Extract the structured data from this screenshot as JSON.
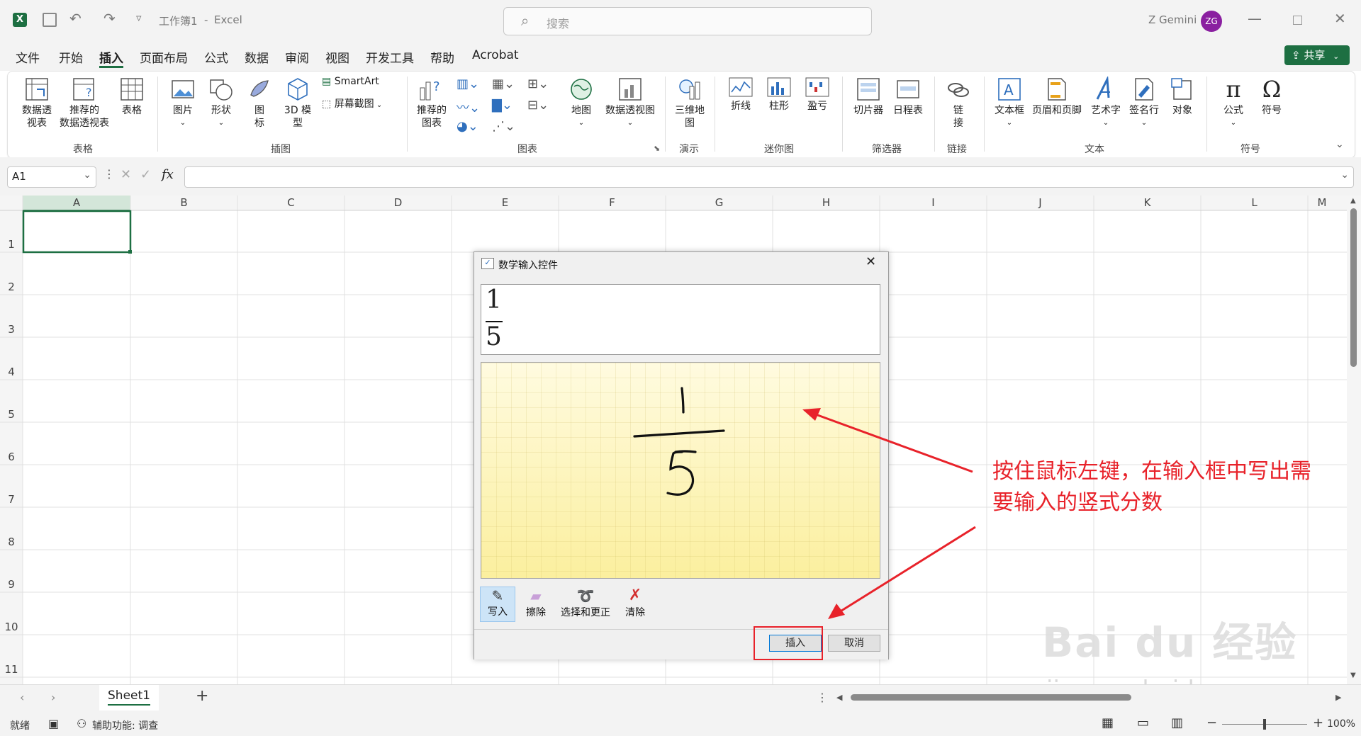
{
  "titlebar": {
    "workbook": "工作簿1",
    "separator": "-",
    "app": "Excel",
    "search_placeholder": "搜索",
    "user_name": "Z Gemini",
    "user_initials": "ZG"
  },
  "menu": {
    "items": [
      "文件",
      "开始",
      "插入",
      "页面布局",
      "公式",
      "数据",
      "审阅",
      "视图",
      "开发工具",
      "帮助",
      "Acrobat"
    ],
    "active": "插入",
    "share": "共享"
  },
  "ribbon": {
    "pivot_table": "数据透\n视表",
    "rec_pivot": "推荐的\n数据透视表",
    "table": "表格",
    "group_tables": "表格",
    "pictures": "图片",
    "shapes": "形状",
    "icons": "图\n标",
    "model3d": "3D 模\n型",
    "smartart": "SmartArt",
    "screenshot": "屏幕截图",
    "group_illustrations": "插图",
    "rec_charts": "推荐的\n图表",
    "maps": "地图",
    "pivot_chart": "数据透视图",
    "group_charts": "图表",
    "map3d": "三维地\n图",
    "group_tours": "演示",
    "line": "折线",
    "column": "柱形",
    "winloss": "盈亏",
    "group_sparklines": "迷你图",
    "slicer": "切片器",
    "timeline": "日程表",
    "group_filters": "筛选器",
    "link": "链\n接",
    "group_links": "链接",
    "textbox": "文本框",
    "header_footer": "页眉和页脚",
    "wordart": "艺术字",
    "signature": "签名行",
    "object": "对象",
    "group_text": "文本",
    "equation": "公式",
    "symbol": "符号",
    "group_symbols": "符号"
  },
  "formula_bar": {
    "name_box": "A1",
    "fx": "fx",
    "value": ""
  },
  "grid": {
    "columns": [
      "A",
      "B",
      "C",
      "D",
      "E",
      "F",
      "G",
      "H",
      "I",
      "J",
      "K",
      "L",
      "M"
    ],
    "rows": [
      "1",
      "2",
      "3",
      "4",
      "5",
      "6",
      "7",
      "8",
      "9",
      "10",
      "11"
    ]
  },
  "dialog": {
    "title": "数学输入控件",
    "preview": {
      "numerator": "1",
      "denominator": "5"
    },
    "tools": [
      "写入",
      "擦除",
      "选择和更正",
      "清除"
    ],
    "insert": "插入",
    "cancel": "取消"
  },
  "annotation": {
    "line1": "按住鼠标左键，在输入框中写出需",
    "line2": "要输入的竖式分数"
  },
  "sheets": {
    "tabs": [
      "Sheet1"
    ],
    "add": "+"
  },
  "status": {
    "ready": "就绪",
    "accessibility": "辅助功能: 调查",
    "zoom": "100%"
  },
  "watermark": {
    "logo": "Bai du 经验",
    "url": "jingyan.baidu.com"
  }
}
